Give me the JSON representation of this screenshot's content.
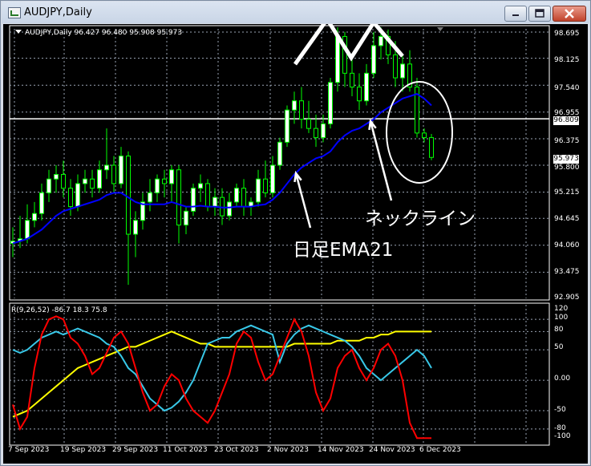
{
  "window": {
    "title": "AUDJPY,Daily"
  },
  "main": {
    "info": "AUDJPY,Daily  96.427 96.480 95.908 95.973",
    "price_levels": [
      "98.695",
      "98.125",
      "97.540",
      "96.955",
      "96.375",
      "95.800",
      "95.215",
      "94.645",
      "94.060",
      "93.475",
      "92.905"
    ],
    "tag_line": "96.809",
    "tag_last": "95.973"
  },
  "sub": {
    "info": "R(9,26,52) -86.7 18.3 75.8",
    "levels": [
      "120",
      "100",
      "80",
      "50",
      "0.00",
      "-50",
      "-80",
      "-100"
    ]
  },
  "dates": [
    "7 Sep 2023",
    "19 Sep 2023",
    "29 Sep 2023",
    "11 Oct 2023",
    "23 Oct 2023",
    "2 Nov 2023",
    "14 Nov 2023",
    "24 Nov 2023",
    "6 Dec 2023"
  ],
  "annotations": {
    "ema_label": "日足EMA21",
    "neck_label": "ネックライン"
  },
  "colors": {
    "candle": "#00ff00",
    "body": "#ffffff",
    "ema": "#0000ff",
    "red": "#ff0000",
    "cyan": "#38c8e8",
    "yellow": "#ffff00"
  },
  "chart_data": {
    "type": "line",
    "candles": [
      [
        94.1,
        94.45,
        93.8,
        94.15
      ],
      [
        94.15,
        94.7,
        94.0,
        94.2
      ],
      [
        94.2,
        94.95,
        94.1,
        94.6
      ],
      [
        94.6,
        95.0,
        94.45,
        94.75
      ],
      [
        94.75,
        95.4,
        94.6,
        95.2
      ],
      [
        95.2,
        95.7,
        95.0,
        95.5
      ],
      [
        95.5,
        95.8,
        95.2,
        95.6
      ],
      [
        95.6,
        95.9,
        95.1,
        95.3
      ],
      [
        95.3,
        95.5,
        94.7,
        94.9
      ],
      [
        94.9,
        95.6,
        94.8,
        95.4
      ],
      [
        95.4,
        95.7,
        95.2,
        95.5
      ],
      [
        95.5,
        95.7,
        95.1,
        95.3
      ],
      [
        95.3,
        95.9,
        95.2,
        95.7
      ],
      [
        95.7,
        96.6,
        95.5,
        95.8
      ],
      [
        95.8,
        96.0,
        95.2,
        95.4
      ],
      [
        95.4,
        96.2,
        95.3,
        96.0
      ],
      [
        96.0,
        96.1,
        93.2,
        94.3
      ],
      [
        94.3,
        94.8,
        93.8,
        94.6
      ],
      [
        94.6,
        95.2,
        94.4,
        95.0
      ],
      [
        95.0,
        95.5,
        94.8,
        95.2
      ],
      [
        95.2,
        95.6,
        95.0,
        95.5
      ],
      [
        95.5,
        95.7,
        95.1,
        95.4
      ],
      [
        95.4,
        95.8,
        95.0,
        95.7
      ],
      [
        95.7,
        95.8,
        94.1,
        94.5
      ],
      [
        94.5,
        94.9,
        94.3,
        94.8
      ],
      [
        94.8,
        95.4,
        94.7,
        95.3
      ],
      [
        95.3,
        95.6,
        95.0,
        95.4
      ],
      [
        95.4,
        95.5,
        94.8,
        94.9
      ],
      [
        94.9,
        95.3,
        94.7,
        95.1
      ],
      [
        95.1,
        95.3,
        94.5,
        94.7
      ],
      [
        94.7,
        95.2,
        94.6,
        95.0
      ],
      [
        95.0,
        95.4,
        94.9,
        95.3
      ],
      [
        95.3,
        95.5,
        94.7,
        94.9
      ],
      [
        94.9,
        95.1,
        94.7,
        95.0
      ],
      [
        95.0,
        95.7,
        94.9,
        95.5
      ],
      [
        95.5,
        95.9,
        95.1,
        95.2
      ],
      [
        95.2,
        96.0,
        95.1,
        95.8
      ],
      [
        95.8,
        96.4,
        95.7,
        96.3
      ],
      [
        96.3,
        97.1,
        96.2,
        97.0
      ],
      [
        97.0,
        97.4,
        96.7,
        97.2
      ],
      [
        97.2,
        97.5,
        96.6,
        96.8
      ],
      [
        96.8,
        97.2,
        96.5,
        96.6
      ],
      [
        96.6,
        96.9,
        96.2,
        96.4
      ],
      [
        96.4,
        96.9,
        96.3,
        96.7
      ],
      [
        96.7,
        97.7,
        96.6,
        97.6
      ],
      [
        97.6,
        98.8,
        97.4,
        98.6
      ],
      [
        98.6,
        98.7,
        97.5,
        97.8
      ],
      [
        97.8,
        98.1,
        97.3,
        97.5
      ],
      [
        97.5,
        97.8,
        97.0,
        97.2
      ],
      [
        97.2,
        98.0,
        97.1,
        97.8
      ],
      [
        97.8,
        98.7,
        97.7,
        98.4
      ],
      [
        98.4,
        98.8,
        98.1,
        98.6
      ],
      [
        98.6,
        98.75,
        98.0,
        98.2
      ],
      [
        98.2,
        98.5,
        97.5,
        97.7
      ],
      [
        97.7,
        98.2,
        97.4,
        98.0
      ],
      [
        98.0,
        98.3,
        97.4,
        97.5
      ],
      [
        97.5,
        97.7,
        96.4,
        96.5
      ],
      [
        96.5,
        96.6,
        96.3,
        96.4
      ],
      [
        96.4,
        96.48,
        95.91,
        95.97
      ]
    ],
    "ema21": [
      94.1,
      94.15,
      94.2,
      94.3,
      94.4,
      94.55,
      94.7,
      94.8,
      94.85,
      94.9,
      94.95,
      95.0,
      95.05,
      95.15,
      95.2,
      95.2,
      95.1,
      95.0,
      94.95,
      94.95,
      94.95,
      94.95,
      95.0,
      94.95,
      94.9,
      94.9,
      94.92,
      94.9,
      94.9,
      94.88,
      94.88,
      94.9,
      94.9,
      94.9,
      94.93,
      94.95,
      95.05,
      95.2,
      95.4,
      95.6,
      95.75,
      95.85,
      95.95,
      96.0,
      96.1,
      96.3,
      96.45,
      96.55,
      96.6,
      96.7,
      96.8,
      96.95,
      97.05,
      97.15,
      97.25,
      97.3,
      97.35,
      97.25,
      97.1
    ],
    "neckline": 96.809,
    "ylim": [
      92.905,
      98.695
    ],
    "rci_red": [
      -40,
      -80,
      -60,
      20,
      75,
      100,
      105,
      100,
      70,
      60,
      40,
      10,
      20,
      45,
      70,
      80,
      60,
      20,
      -20,
      -50,
      -40,
      -10,
      10,
      0,
      -30,
      -50,
      -60,
      -70,
      -50,
      -20,
      10,
      60,
      80,
      70,
      30,
      0,
      10,
      40,
      70,
      100,
      80,
      40,
      -20,
      -50,
      -30,
      20,
      40,
      50,
      20,
      0,
      20,
      50,
      60,
      40,
      0,
      -70,
      -95,
      -95,
      -95
    ],
    "rci_cyan": [
      50,
      45,
      50,
      60,
      70,
      75,
      80,
      75,
      80,
      85,
      80,
      75,
      70,
      60,
      55,
      40,
      20,
      10,
      -10,
      -30,
      -40,
      -50,
      -45,
      -35,
      -20,
      0,
      30,
      60,
      65,
      70,
      70,
      80,
      85,
      90,
      85,
      80,
      75,
      30,
      60,
      75,
      85,
      90,
      85,
      80,
      75,
      70,
      65,
      55,
      40,
      20,
      10,
      0,
      10,
      20,
      30,
      40,
      50,
      40,
      20
    ],
    "rci_yellow": [
      -60,
      -55,
      -50,
      -40,
      -30,
      -20,
      -10,
      0,
      10,
      20,
      25,
      30,
      35,
      40,
      45,
      50,
      55,
      55,
      60,
      65,
      70,
      75,
      80,
      75,
      70,
      65,
      60,
      60,
      55,
      55,
      55,
      55,
      55,
      55,
      55,
      55,
      55,
      55,
      55,
      60,
      60,
      60,
      60,
      60,
      60,
      65,
      65,
      65,
      65,
      70,
      70,
      75,
      75,
      80,
      80,
      80,
      80,
      80,
      80
    ],
    "rci_ylim": [
      -100,
      120
    ]
  }
}
